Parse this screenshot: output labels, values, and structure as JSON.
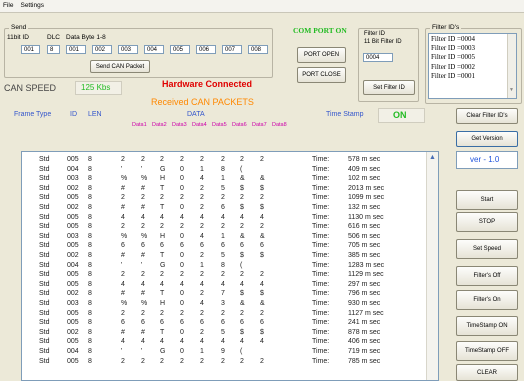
{
  "menu": {
    "file": "File",
    "settings": "Settings"
  },
  "send": {
    "group_label": "Send",
    "id_label": "11bit ID",
    "dlc_label": "DLC",
    "data_label": "Data Byte 1-8",
    "id_value": "001",
    "dlc_value": "8",
    "bytes": [
      "001",
      "002",
      "003",
      "004",
      "005",
      "006",
      "007",
      "008"
    ],
    "send_button": "Send CAN Packet"
  },
  "port": {
    "status": "COM PORT ON",
    "open_button": "PORT OPEN",
    "close_button": "PORT CLOSE"
  },
  "filter": {
    "label1": "Filter ID",
    "label2": "11 Bit Filter ID",
    "value": "0004",
    "set_button": "Set Filter ID",
    "ids_label": "Filter ID's",
    "ids": [
      "Filter ID =0004",
      "Filter ID =0003",
      "Filter ID =0005",
      "Filter ID =0002",
      "Filter ID =0001"
    ],
    "clear_button": "Clear Filter ID's"
  },
  "speed": {
    "label": "CAN SPEED",
    "value": "125 Kbs"
  },
  "hardware_status": "Hardware Connected",
  "received_title": "Received CAN PACKETS",
  "columns": {
    "frame_type": "Frame Type",
    "id": "ID",
    "len": "LEN",
    "data": "DATA",
    "timestamp": "Time Stamp",
    "ts_state": "ON",
    "data_sub": [
      "Data1",
      "Data2",
      "Data3",
      "Data4",
      "Data5",
      "Data6",
      "Data7",
      "Data8"
    ]
  },
  "version": {
    "button": "Get Version",
    "value": "ver - 1.0"
  },
  "side_buttons": [
    "Start",
    "STOP",
    "Set Speed",
    "Filter's Off",
    "Filter's On",
    "TimeStamp ON",
    "TimeStamp OFF",
    "CLEAR"
  ],
  "log": [
    {
      "type": "Std",
      "id": "005",
      "len": "8",
      "d": [
        "2",
        "2",
        "2",
        "2",
        "2",
        "2",
        "2",
        "2"
      ],
      "tl": "Time:",
      "tv": "578 m sec"
    },
    {
      "type": "Std",
      "id": "004",
      "len": "8",
      "d": [
        "'",
        "'",
        "G",
        "0",
        "1",
        "8",
        "(",
        ""
      ],
      "tl": "Time:",
      "tv": "409 m sec"
    },
    {
      "type": "Std",
      "id": "003",
      "len": "8",
      "d": [
        "%",
        "%",
        "H",
        "0",
        "4",
        "1",
        "&",
        "&"
      ],
      "tl": "Time:",
      "tv": "102 m sec"
    },
    {
      "type": "Std",
      "id": "002",
      "len": "8",
      "d": [
        "#",
        "#",
        "T",
        "0",
        "2",
        "5",
        "$",
        "$"
      ],
      "tl": "Time:",
      "tv": "2013 m sec"
    },
    {
      "type": "Std",
      "id": "005",
      "len": "8",
      "d": [
        "2",
        "2",
        "2",
        "2",
        "2",
        "2",
        "2",
        "2"
      ],
      "tl": "Time:",
      "tv": "1099 m sec"
    },
    {
      "type": "Std",
      "id": "002",
      "len": "8",
      "d": [
        "#",
        "#",
        "T",
        "0",
        "2",
        "6",
        "$",
        "$"
      ],
      "tl": "Time:",
      "tv": "132 m sec"
    },
    {
      "type": "Std",
      "id": "005",
      "len": "8",
      "d": [
        "4",
        "4",
        "4",
        "4",
        "4",
        "4",
        "4",
        "4"
      ],
      "tl": "Time:",
      "tv": "1130 m sec"
    },
    {
      "type": "Std",
      "id": "005",
      "len": "8",
      "d": [
        "2",
        "2",
        "2",
        "2",
        "2",
        "2",
        "2",
        "2"
      ],
      "tl": "Time:",
      "tv": "616 m sec"
    },
    {
      "type": "Std",
      "id": "003",
      "len": "8",
      "d": [
        "%",
        "%",
        "H",
        "0",
        "4",
        "1",
        "&",
        "&"
      ],
      "tl": "Time:",
      "tv": "506 m sec"
    },
    {
      "type": "Std",
      "id": "005",
      "len": "8",
      "d": [
        "6",
        "6",
        "6",
        "6",
        "6",
        "6",
        "6",
        "6"
      ],
      "tl": "Time:",
      "tv": "705 m sec"
    },
    {
      "type": "Std",
      "id": "002",
      "len": "8",
      "d": [
        "#",
        "#",
        "T",
        "0",
        "2",
        "5",
        "$",
        "$"
      ],
      "tl": "Time:",
      "tv": "385 m sec"
    },
    {
      "type": "Std",
      "id": "004",
      "len": "8",
      "d": [
        "'",
        "'",
        "G",
        "0",
        "1",
        "8",
        "(",
        ""
      ],
      "tl": "Time:",
      "tv": "1283 m sec"
    },
    {
      "type": "Std",
      "id": "005",
      "len": "8",
      "d": [
        "2",
        "2",
        "2",
        "2",
        "2",
        "2",
        "2",
        "2"
      ],
      "tl": "Time:",
      "tv": "1129 m sec"
    },
    {
      "type": "Std",
      "id": "005",
      "len": "8",
      "d": [
        "4",
        "4",
        "4",
        "4",
        "4",
        "4",
        "4",
        "4"
      ],
      "tl": "Time:",
      "tv": "297 m sec"
    },
    {
      "type": "Std",
      "id": "002",
      "len": "8",
      "d": [
        "#",
        "#",
        "T",
        "0",
        "2",
        "7",
        "$",
        "$"
      ],
      "tl": "Time:",
      "tv": "796 m sec"
    },
    {
      "type": "Std",
      "id": "003",
      "len": "8",
      "d": [
        "%",
        "%",
        "H",
        "0",
        "4",
        "3",
        "&",
        "&"
      ],
      "tl": "Time:",
      "tv": "930 m sec"
    },
    {
      "type": "Std",
      "id": "005",
      "len": "8",
      "d": [
        "2",
        "2",
        "2",
        "2",
        "2",
        "2",
        "2",
        "2"
      ],
      "tl": "Time:",
      "tv": "1127 m sec"
    },
    {
      "type": "Std",
      "id": "005",
      "len": "8",
      "d": [
        "6",
        "6",
        "6",
        "6",
        "6",
        "6",
        "6",
        "6"
      ],
      "tl": "Time:",
      "tv": "241 m sec"
    },
    {
      "type": "Std",
      "id": "002",
      "len": "8",
      "d": [
        "#",
        "#",
        "T",
        "0",
        "2",
        "5",
        "$",
        "$"
      ],
      "tl": "Time:",
      "tv": "878 m sec"
    },
    {
      "type": "Std",
      "id": "005",
      "len": "8",
      "d": [
        "4",
        "4",
        "4",
        "4",
        "4",
        "4",
        "4",
        "4"
      ],
      "tl": "Time:",
      "tv": "406 m sec"
    },
    {
      "type": "Std",
      "id": "004",
      "len": "8",
      "d": [
        "'",
        "'",
        "G",
        "0",
        "1",
        "9",
        "(",
        ""
      ],
      "tl": "Time:",
      "tv": "719 m sec"
    },
    {
      "type": "Std",
      "id": "005",
      "len": "8",
      "d": [
        "2",
        "2",
        "2",
        "2",
        "2",
        "2",
        "2",
        "2"
      ],
      "tl": "Time:",
      "tv": "785 m sec"
    }
  ],
  "colors": {
    "green": "#22bb22",
    "red": "#e00000",
    "orange": "#ff8800",
    "blue": "#3355cc",
    "magenta": "#cc00aa"
  }
}
